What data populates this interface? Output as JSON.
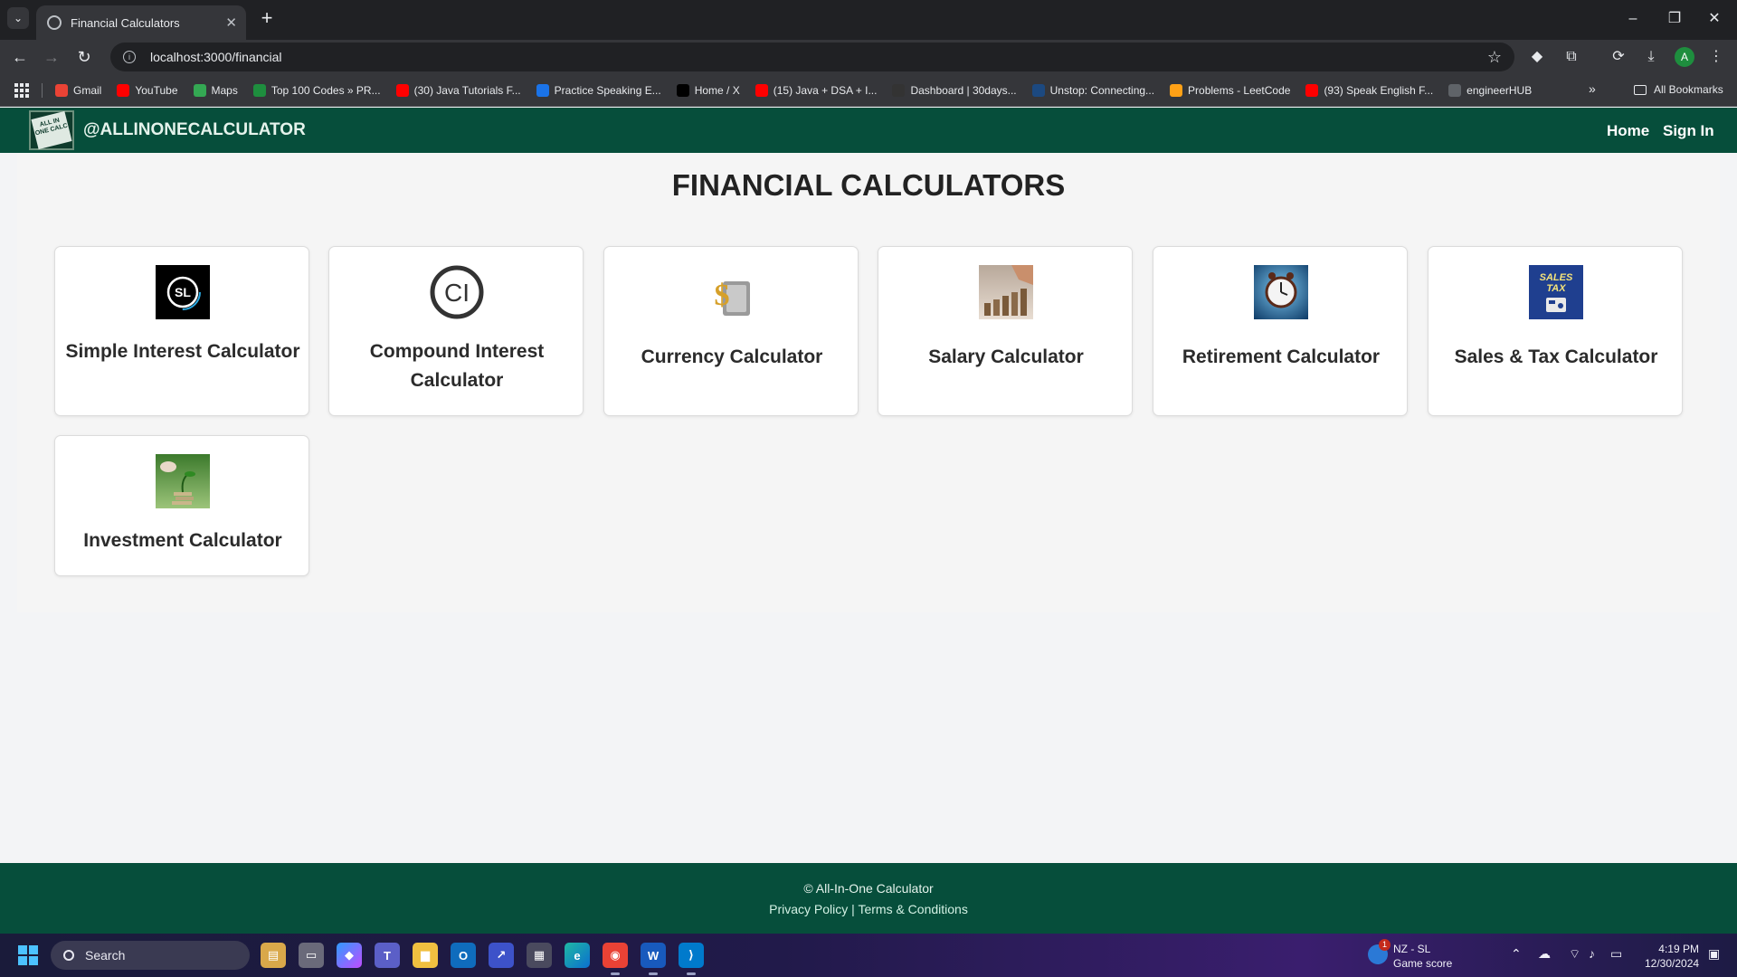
{
  "browser": {
    "tab_title": "Financial Calculators",
    "url": "localhost:3000/financial",
    "profile_initial": "A",
    "bookmarks": [
      {
        "label": "Gmail",
        "color": "#ea4335",
        "icon": "gmail-icon"
      },
      {
        "label": "YouTube",
        "color": "#ff0000",
        "icon": "youtube-icon"
      },
      {
        "label": "Maps",
        "color": "#34a853",
        "icon": "maps-icon"
      },
      {
        "label": "Top 100 Codes » PR...",
        "color": "#1e8e3e",
        "icon": "site-icon"
      },
      {
        "label": "(30) Java Tutorials F...",
        "color": "#ff0000",
        "icon": "youtube-icon"
      },
      {
        "label": "Practice Speaking E...",
        "color": "#1a73e8",
        "icon": "site-icon"
      },
      {
        "label": "Home / X",
        "color": "#000000",
        "icon": "x-icon"
      },
      {
        "label": "(15) Java + DSA + I...",
        "color": "#ff0000",
        "icon": "youtube-icon"
      },
      {
        "label": "Dashboard | 30days...",
        "color": "#333333",
        "icon": "site-icon"
      },
      {
        "label": "Unstop: Connecting...",
        "color": "#1c4980",
        "icon": "unstop-icon"
      },
      {
        "label": "Problems - LeetCode",
        "color": "#ffa116",
        "icon": "leetcode-icon"
      },
      {
        "label": "(93) Speak English F...",
        "color": "#ff0000",
        "icon": "youtube-icon"
      },
      {
        "label": "engineerHUB",
        "color": "#5f6368",
        "icon": "site-icon"
      }
    ],
    "all_bookmarks": "All Bookmarks"
  },
  "site": {
    "brand": "@ALLINONECALCULATOR",
    "logo_text": "ALL IN ONE CALC",
    "nav_home": "Home",
    "nav_signin": "Sign In",
    "page_title": "FINANCIAL CALCULATORS",
    "cards": [
      {
        "label": "Simple Interest Calculator",
        "icon": "simple-interest-icon"
      },
      {
        "label": "Compound Interest Calculator",
        "icon": "compound-interest-icon"
      },
      {
        "label": "Currency Calculator",
        "icon": "currency-icon"
      },
      {
        "label": "Salary Calculator",
        "icon": "salary-icon"
      },
      {
        "label": "Retirement Calculator",
        "icon": "retirement-icon"
      },
      {
        "label": "Sales & Tax Calculator",
        "icon": "sales-tax-icon"
      },
      {
        "label": "Investment Calculator",
        "icon": "investment-icon"
      }
    ],
    "sl_text": "SL",
    "ci_text": "CI",
    "sales_tax_text": "SALES TAX",
    "footer_copy": "© All-In-One Calculator",
    "footer_privacy": "Privacy Policy",
    "footer_sep": " | ",
    "footer_terms": "Terms & Conditions"
  },
  "taskbar": {
    "search_label": "Search",
    "weather_line1": "NZ - SL",
    "weather_line2": "Game score",
    "weather_badge": "1",
    "time": "4:19 PM",
    "date": "12/30/2024"
  },
  "colors": {
    "nav_green": "#064e3b",
    "accent_blue": "#4cc2ff"
  }
}
